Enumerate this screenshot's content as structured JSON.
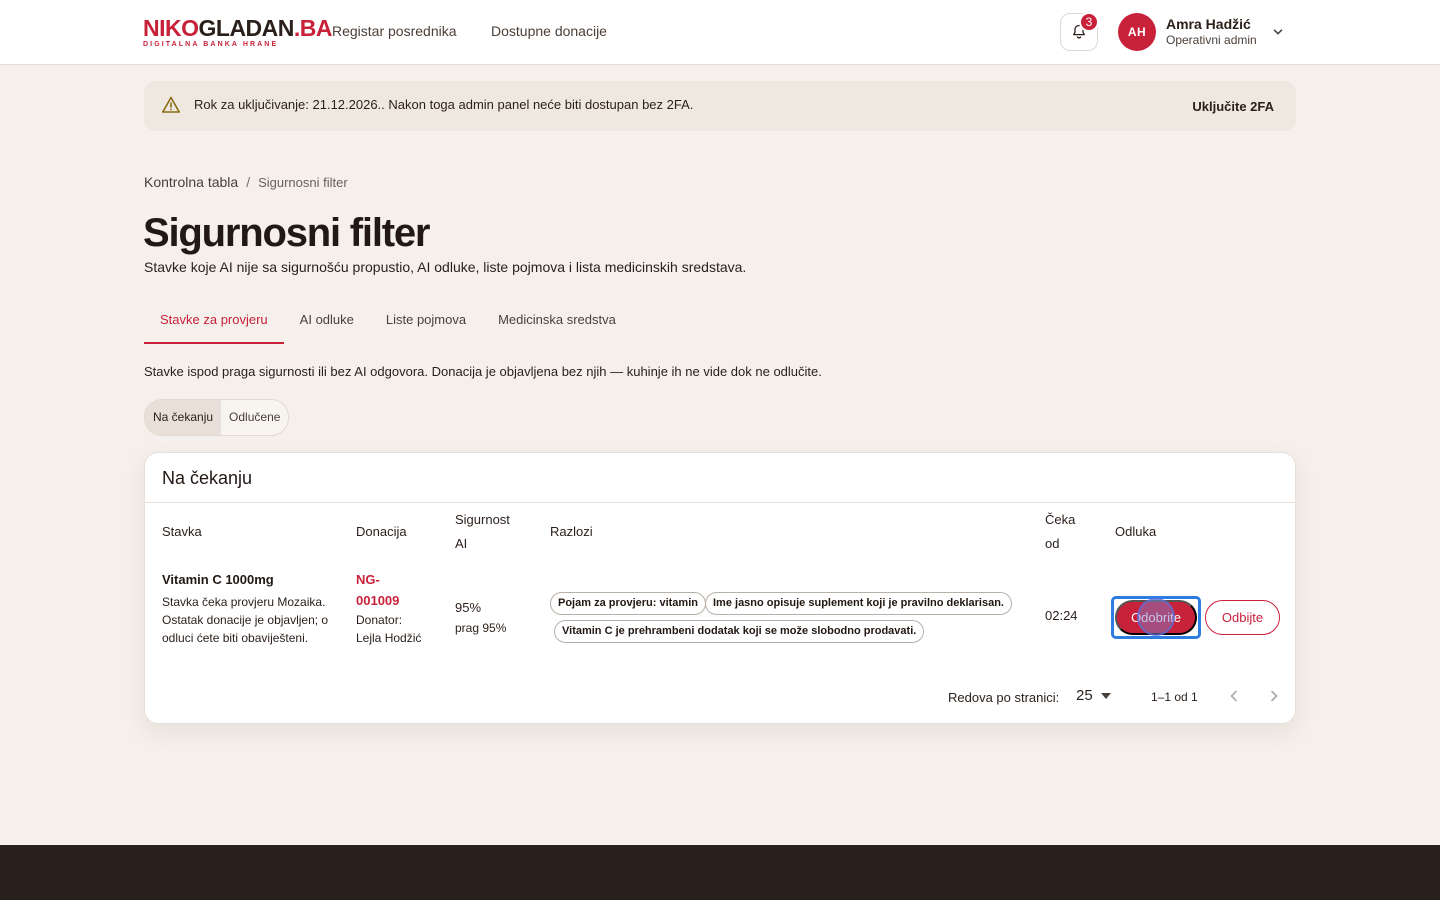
{
  "header": {
    "logo_part1": "NIKO",
    "logo_part2": "GLADAN",
    "logo_part3": ".BA",
    "logo_tagline": "DIGITALNA BANKA HRANE",
    "nav": [
      "Registar posrednika",
      "Dostupne donacije"
    ],
    "notification_count": "3",
    "user": {
      "initials": "AH",
      "name": "Amra Hadžić",
      "role": "Operativni admin"
    }
  },
  "alert": {
    "text": "Rok za uključivanje: 21.12.2026.. Nakon toga admin panel neće biti dostupan bez 2FA.",
    "action": "Uključite 2FA"
  },
  "breadcrumb": {
    "home": "Kontrolna tabla",
    "separator": "/",
    "current": "Sigurnosni filter"
  },
  "page": {
    "title": "Sigurnosni filter",
    "subtitle": "Stavke koje AI nije sa sigurnošću propustio, AI odluke, liste pojmova i lista medicinskih sredstava."
  },
  "tabs": [
    "Stavke za provjeru",
    "AI odluke",
    "Liste pojmova",
    "Medicinska sredstva"
  ],
  "tab_description": "Stavke ispod praga sigurnosti ili bez AI odgovora. Donacija je objavljena bez njih — kuhinje ih ne vide dok ne odlučite.",
  "segments": [
    "Na čekanju",
    "Odlučene"
  ],
  "card": {
    "title": "Na čekanju",
    "columns": {
      "item": "Stavka",
      "donation": "Donacija",
      "confidence_1": "Sigurnost",
      "confidence_2": "AI",
      "reasons": "Razlozi",
      "waiting_1": "Čeka",
      "waiting_2": "od",
      "decision": "Odluka"
    },
    "row": {
      "item_name": "Vitamin C 1000mg",
      "item_desc": "Stavka čeka provjeru Mozaika. Ostatak donacije je objavljen; o odluci ćete biti obaviješteni.",
      "donation_id": "NG-001009",
      "donor": "Donator: Lejla Hodžić",
      "confidence": "95%",
      "threshold": "prag 95%",
      "reasons": [
        "Pojam za provjeru: vitamin",
        "Ime jasno opisuje suplement koji je pravilno deklarisan.",
        "Vitamin C je prehrambeni dodatak koji se može slobodno prodavati."
      ],
      "waiting": "02:24",
      "approve": "Odobrite",
      "reject": "Odbijte"
    },
    "pagination": {
      "label": "Redova po stranici:",
      "per_page": "25",
      "range": "1–1 od 1"
    }
  },
  "colors": {
    "brand": "#c8213a",
    "background": "#f5f0eb",
    "footer": "#2a201b",
    "focus": "#2f7de0"
  }
}
